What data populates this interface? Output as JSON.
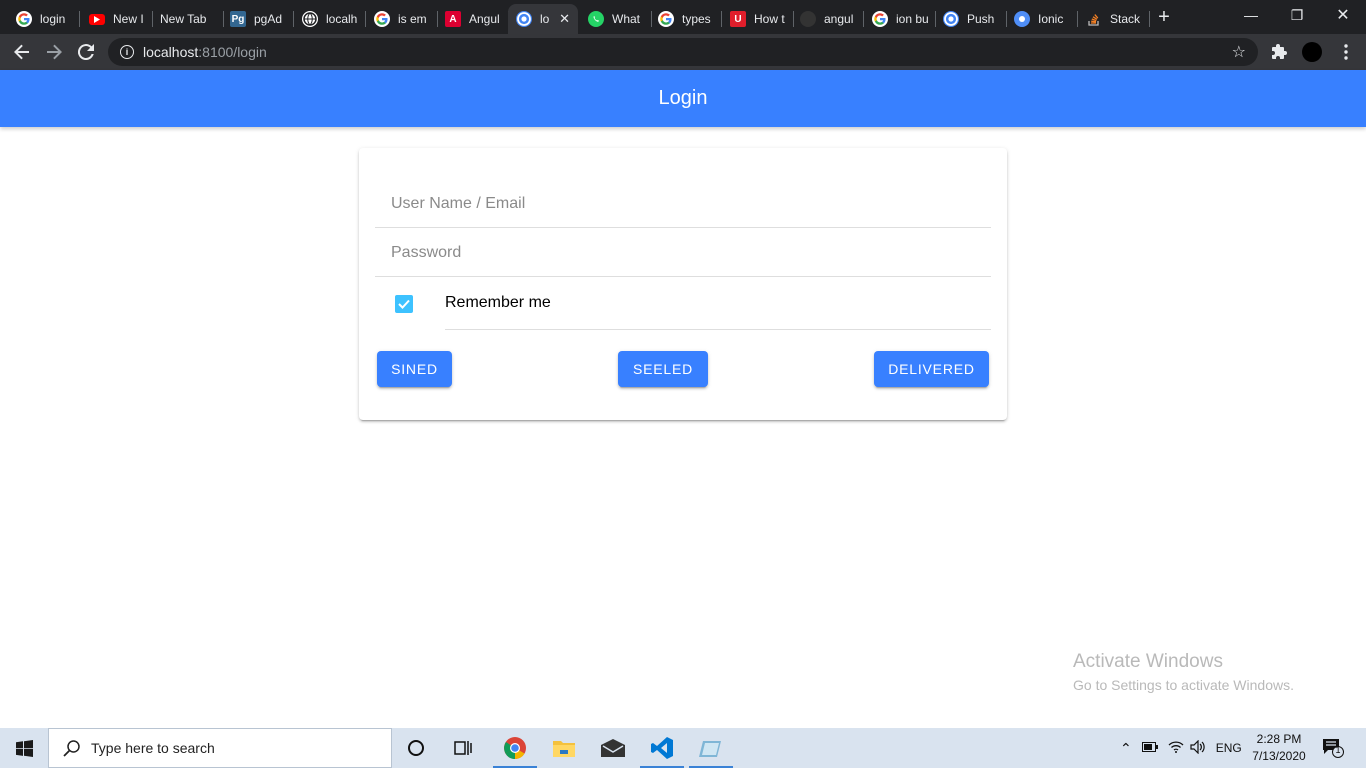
{
  "browser": {
    "tabs": [
      {
        "title": "login",
        "favicon": "google-icon",
        "color": "#ffffff"
      },
      {
        "title": "New I",
        "favicon": "youtube-icon",
        "color": "#ff0000"
      },
      {
        "title": "New Tab",
        "favicon": "",
        "color": ""
      },
      {
        "title": "pgAd",
        "favicon": "pgadmin-icon",
        "color": "#336791"
      },
      {
        "title": "localh",
        "favicon": "globe-icon",
        "color": "#ffffff"
      },
      {
        "title": "is em",
        "favicon": "google-icon",
        "color": "#ffffff"
      },
      {
        "title": "Angul",
        "favicon": "angular-icon",
        "color": "#dd0031"
      },
      {
        "title": "lo",
        "favicon": "ionic-icon",
        "color": "#4285f4",
        "active": true
      },
      {
        "title": "What",
        "favicon": "whatsapp-icon",
        "color": "#25d366"
      },
      {
        "title": "types",
        "favicon": "google-icon",
        "color": "#ffffff"
      },
      {
        "title": "How t",
        "favicon": "udemy-icon",
        "color": "#e01e2b"
      },
      {
        "title": "angul",
        "favicon": "github-icon",
        "color": "#333333"
      },
      {
        "title": "ion bu",
        "favicon": "google-icon",
        "color": "#ffffff"
      },
      {
        "title": "Push",
        "favicon": "ionic-icon",
        "color": "#4285f4"
      },
      {
        "title": "Ionic",
        "favicon": "capacitor-icon",
        "color": "#4f8ef7"
      },
      {
        "title": "Stack",
        "favicon": "stackoverflow-icon",
        "color": "#f48024"
      }
    ],
    "url_host": "localhost",
    "url_path": ":8100/login"
  },
  "app": {
    "header_title": "Login",
    "username_placeholder": "User Name / Email",
    "password_placeholder": "Password",
    "remember_label": "Remember me",
    "remember_checked": true,
    "buttons": {
      "sined": "SINED",
      "seeled": "SEELED",
      "delivered": "DELIVERED"
    },
    "primary_color": "#3880ff",
    "checkbox_color": "#3dc2ff"
  },
  "watermark": {
    "line1": "Activate Windows",
    "line2": "Go to Settings to activate Windows."
  },
  "taskbar": {
    "search_placeholder": "Type here to search",
    "language": "ENG",
    "time": "2:28 PM",
    "date": "7/13/2020",
    "notification_count": "1"
  }
}
